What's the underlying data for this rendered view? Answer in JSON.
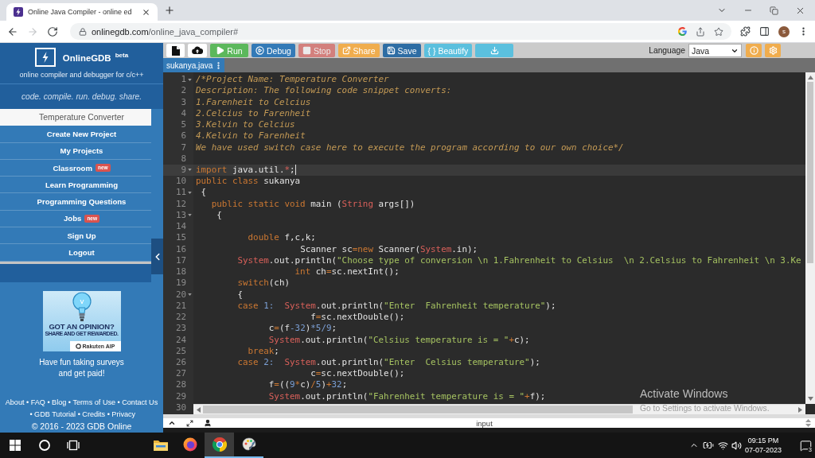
{
  "browser": {
    "tab": {
      "title": "Online Java Compiler - online ed"
    },
    "nav": [
      {
        "kind": "back",
        "disabled": false
      },
      {
        "kind": "forward",
        "disabled": true
      },
      {
        "kind": "reload",
        "disabled": false
      }
    ],
    "address": {
      "host": "onlinegdb.com",
      "path": "/online_java_compiler#"
    },
    "profile": {
      "initial": "s"
    }
  },
  "sidebar": {
    "brand": "OnlineGDB $^{beta}$",
    "subtitle": "online compiler and debugger for c/c++",
    "tagline": "code. compile. run. debug. share.",
    "menu": [
      {
        "label": "Temperature Converter",
        "selected": true
      },
      {
        "label": "Create New Project",
        "selected": false
      },
      {
        "label": "My Projects",
        "selected": false
      },
      {
        "label": "Classroom",
        "selected": false,
        "badge": "new"
      },
      {
        "label": "Learn Programming",
        "selected": false
      },
      {
        "label": "Programming Questions",
        "selected": false
      },
      {
        "label": "Jobs",
        "selected": false,
        "badge": "new"
      },
      {
        "label": "Sign Up",
        "selected": false
      },
      {
        "label": "Logout",
        "selected": false
      }
    ],
    "ad": {
      "headline": "GOT AN OPINION?",
      "subline": "SHARE AND GET REWARDED.",
      "brand": "Rakuten AIP"
    },
    "promo": [
      "Have fun taking surveys",
      "and get paid!"
    ],
    "footer": {
      "separator": "•",
      "links": [
        "About",
        "FAQ",
        "Blog",
        "Terms of Use",
        "Contact Us",
        "GDB Tutorial",
        "Credits",
        "Privacy"
      ],
      "copyright": "© 2016 - 2023 GDB Online"
    }
  },
  "toolbar": {
    "buttons": [
      {
        "kind": "new-file",
        "disabled": false
      },
      {
        "kind": "upload",
        "disabled": false
      },
      {
        "kind": "run",
        "label": "Run",
        "disabled": false
      },
      {
        "kind": "debug",
        "label": "Debug",
        "disabled": false
      },
      {
        "kind": "stop",
        "label": "Stop",
        "disabled": true
      },
      {
        "kind": "share",
        "label": "Share",
        "disabled": false
      },
      {
        "kind": "save",
        "label": "Save",
        "disabled": false
      },
      {
        "kind": "beautify",
        "label": "{ } Beautify",
        "disabled": false
      },
      {
        "kind": "download",
        "disabled": false
      }
    ],
    "language": {
      "label": "Language",
      "value": "Java"
    }
  },
  "file_tabs": [
    {
      "name": "sukanya.java",
      "selected": true
    }
  ],
  "editor": {
    "lines": [
      {
        "number": "1",
        "fold": true,
        "active": false,
        "tokens": [
          {
            "kind": "comment",
            "text": "/*Project Name: Temperature Converter"
          }
        ]
      },
      {
        "number": "2",
        "fold": false,
        "active": false,
        "tokens": [
          {
            "kind": "comment",
            "text": "Description: The following code snippet converts:"
          }
        ]
      },
      {
        "number": "3",
        "fold": false,
        "active": false,
        "tokens": [
          {
            "kind": "comment",
            "text": "1.Farenheit to Celcius"
          }
        ]
      },
      {
        "number": "4",
        "fold": false,
        "active": false,
        "tokens": [
          {
            "kind": "comment",
            "text": "2.Celcius to Farenheit"
          }
        ]
      },
      {
        "number": "5",
        "fold": false,
        "active": false,
        "tokens": [
          {
            "kind": "comment",
            "text": "3.Kelvin to Celcius"
          }
        ]
      },
      {
        "number": "6",
        "fold": false,
        "active": false,
        "tokens": [
          {
            "kind": "comment",
            "text": "4.Kelvin to Farenheit"
          }
        ]
      },
      {
        "number": "7",
        "fold": false,
        "active": false,
        "tokens": [
          {
            "kind": "comment",
            "text": "We have used switch case here to execute the program according to our own choice*/"
          }
        ]
      },
      {
        "number": "8",
        "fold": false,
        "active": false
      },
      {
        "number": "9",
        "fold": true,
        "active": true,
        "tokens": [
          {
            "kind": "keyword",
            "text": "import"
          },
          {
            "kind": "plain",
            "text": " java.util."
          },
          {
            "kind": "class",
            "text": "*"
          },
          {
            "kind": "plain",
            "text": ";"
          }
        ]
      },
      {
        "number": "10",
        "fold": false,
        "active": false,
        "tokens": [
          {
            "kind": "keyword",
            "text": "public class"
          },
          {
            "kind": "plain",
            "text": " sukanya"
          }
        ]
      },
      {
        "number": "11",
        "fold": true,
        "active": false,
        "tokens": [
          {
            "kind": "plain",
            "text": " {"
          }
        ]
      },
      {
        "number": "12",
        "fold": false,
        "active": false,
        "tokens": [
          {
            "kind": "keyword",
            "text": "   public static void"
          },
          {
            "kind": "plain",
            "text": " main ("
          },
          {
            "kind": "class",
            "text": "String"
          },
          {
            "kind": "plain",
            "text": " args[])"
          }
        ]
      },
      {
        "number": "13",
        "fold": true,
        "active": false,
        "tokens": [
          {
            "kind": "plain",
            "text": "    {"
          }
        ]
      },
      {
        "number": "14",
        "fold": false,
        "active": false
      },
      {
        "number": "15",
        "fold": false,
        "active": false,
        "tokens": [
          {
            "kind": "keyword",
            "text": "          double"
          },
          {
            "kind": "plain",
            "text": " f,c,k;"
          }
        ]
      },
      {
        "number": "16",
        "fold": false,
        "active": false,
        "tokens": [
          {
            "kind": "plain",
            "text": "                    Scanner sc"
          },
          {
            "kind": "operator",
            "text": "="
          },
          {
            "kind": "keyword",
            "text": "new"
          },
          {
            "kind": "plain",
            "text": " Scanner("
          },
          {
            "kind": "class",
            "text": "System"
          },
          {
            "kind": "plain",
            "text": ".in);"
          }
        ]
      },
      {
        "number": "17",
        "fold": false,
        "active": false,
        "tokens": [
          {
            "kind": "class",
            "text": "        System"
          },
          {
            "kind": "plain",
            "text": ".out.println("
          },
          {
            "kind": "string",
            "text": "\"Choose type of conversion \\n 1.Fahrenheit to Celsius  \\n 2.Celsius to Fahrenheit \\n 3.Ke"
          }
        ]
      },
      {
        "number": "18",
        "fold": false,
        "active": false,
        "tokens": [
          {
            "kind": "keyword",
            "text": "                   int"
          },
          {
            "kind": "plain",
            "text": " ch"
          },
          {
            "kind": "operator",
            "text": "="
          },
          {
            "kind": "plain",
            "text": "sc.nextInt();"
          }
        ]
      },
      {
        "number": "19",
        "fold": false,
        "active": false,
        "tokens": [
          {
            "kind": "keyword",
            "text": "        switch"
          },
          {
            "kind": "plain",
            "text": "(ch)"
          }
        ]
      },
      {
        "number": "20",
        "fold": true,
        "active": false,
        "tokens": [
          {
            "kind": "plain",
            "text": "        {"
          }
        ]
      },
      {
        "number": "21",
        "fold": false,
        "active": false,
        "tokens": [
          {
            "kind": "keyword",
            "text": "        case"
          },
          {
            "kind": "number",
            "text": " 1:"
          },
          {
            "kind": "class",
            "text": "  System"
          },
          {
            "kind": "plain",
            "text": ".out.println("
          },
          {
            "kind": "string",
            "text": "\"Enter  Fahrenheit temperature\""
          },
          {
            "kind": "plain",
            "text": ");"
          }
        ]
      },
      {
        "number": "22",
        "fold": false,
        "active": false,
        "tokens": [
          {
            "kind": "plain",
            "text": "                      f"
          },
          {
            "kind": "operator",
            "text": "="
          },
          {
            "kind": "plain",
            "text": "sc.nextDouble();"
          }
        ]
      },
      {
        "number": "23",
        "fold": false,
        "active": false,
        "tokens": [
          {
            "kind": "plain",
            "text": "              c"
          },
          {
            "kind": "operator",
            "text": "="
          },
          {
            "kind": "plain",
            "text": "(f"
          },
          {
            "kind": "number",
            "text": "-32"
          },
          {
            "kind": "plain",
            "text": ")"
          },
          {
            "kind": "number",
            "text": "*5/9"
          },
          {
            "kind": "plain",
            "text": ";"
          }
        ]
      },
      {
        "number": "24",
        "fold": false,
        "active": false,
        "tokens": [
          {
            "kind": "class",
            "text": "              System"
          },
          {
            "kind": "plain",
            "text": ".out.println("
          },
          {
            "kind": "string",
            "text": "\"Celsius temperature is = \""
          },
          {
            "kind": "operator",
            "text": "+"
          },
          {
            "kind": "plain",
            "text": "c);"
          }
        ]
      },
      {
        "number": "25",
        "fold": false,
        "active": false,
        "tokens": [
          {
            "kind": "keyword",
            "text": "          break"
          },
          {
            "kind": "plain",
            "text": ";"
          }
        ]
      },
      {
        "number": "26",
        "fold": false,
        "active": false,
        "tokens": [
          {
            "kind": "keyword",
            "text": "        case"
          },
          {
            "kind": "number",
            "text": " 2:"
          },
          {
            "kind": "class",
            "text": "  System"
          },
          {
            "kind": "plain",
            "text": ".out.println("
          },
          {
            "kind": "string",
            "text": "\"Enter  Celsius temperature\""
          },
          {
            "kind": "plain",
            "text": ");"
          }
        ]
      },
      {
        "number": "27",
        "fold": false,
        "active": false,
        "tokens": [
          {
            "kind": "plain",
            "text": "                      c"
          },
          {
            "kind": "operator",
            "text": "="
          },
          {
            "kind": "plain",
            "text": "sc.nextDouble();"
          }
        ]
      },
      {
        "number": "28",
        "fold": false,
        "active": false,
        "tokens": [
          {
            "kind": "plain",
            "text": "              f"
          },
          {
            "kind": "operator",
            "text": "="
          },
          {
            "kind": "plain",
            "text": "(("
          },
          {
            "kind": "number",
            "text": "9"
          },
          {
            "kind": "operator",
            "text": "*"
          },
          {
            "kind": "plain",
            "text": "c)"
          },
          {
            "kind": "operator",
            "text": "/"
          },
          {
            "kind": "number",
            "text": "5"
          },
          {
            "kind": "plain",
            "text": ")"
          },
          {
            "kind": "operator",
            "text": "+"
          },
          {
            "kind": "number",
            "text": "32"
          },
          {
            "kind": "plain",
            "text": ";"
          }
        ]
      },
      {
        "number": "29",
        "fold": false,
        "active": false,
        "tokens": [
          {
            "kind": "class",
            "text": "              System"
          },
          {
            "kind": "plain",
            "text": ".out.println("
          },
          {
            "kind": "string",
            "text": "\"Fahrenheit temperature is = \""
          },
          {
            "kind": "operator",
            "text": "+"
          },
          {
            "kind": "plain",
            "text": "f);"
          }
        ]
      },
      {
        "number": "30",
        "fold": false,
        "active": false
      }
    ]
  },
  "console": {
    "label": "input"
  },
  "os_notice": {
    "title": "Activate Windows",
    "subtitle": "Go to Settings to activate Windows."
  },
  "taskbar": {
    "apps": [
      {
        "kind": "folder",
        "selected": false,
        "running": false
      },
      {
        "kind": "firefox",
        "selected": false,
        "running": false
      },
      {
        "kind": "chrome",
        "selected": true,
        "running": true
      },
      {
        "kind": "paint",
        "selected": false,
        "running": true
      }
    ],
    "time": "09:15 PM",
    "date": "07-07-2023",
    "notifications": "3"
  }
}
